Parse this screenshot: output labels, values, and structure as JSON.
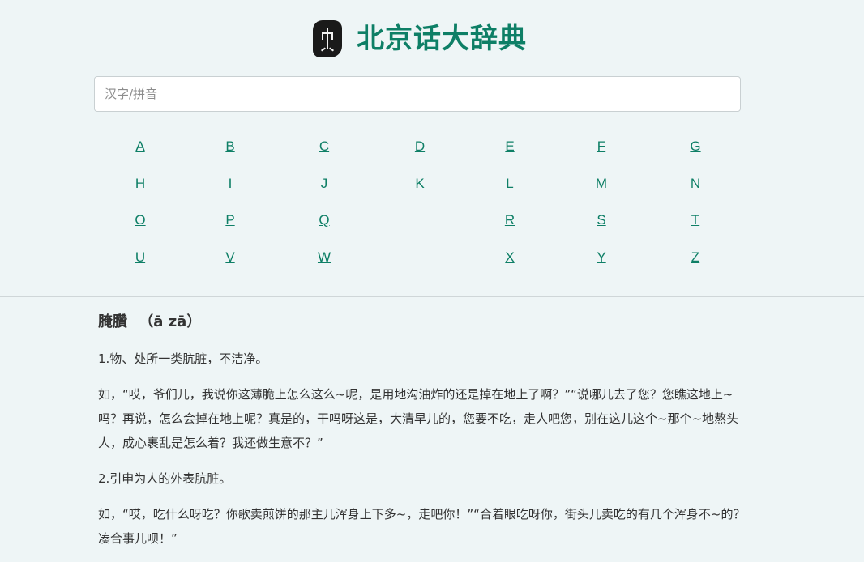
{
  "header": {
    "site_title": "北京话大辞典",
    "logo_icon": "seal-logo-icon"
  },
  "search": {
    "placeholder": "汉字/拼音",
    "value": ""
  },
  "alphabet": {
    "row1": [
      "A",
      "B",
      "C",
      "D",
      "E",
      "F",
      "G"
    ],
    "row2": [
      "H",
      "I",
      "J",
      "K",
      "L",
      "M",
      "N"
    ],
    "row3": [
      "O",
      "P",
      "Q",
      "R",
      "S",
      "T"
    ],
    "row4": [
      "U",
      "V",
      "W",
      "X",
      "Y",
      "Z"
    ]
  },
  "entry": {
    "headword": "腌臢",
    "pinyin": "（ā zā）",
    "def1": "1.物、处所一类肮脏，不洁净。",
    "ex1": "如，“哎，爷们儿，我说你这薄脆上怎么这么~呢，是用地沟油炸的还是掉在地上了啊？”“说哪儿去了您？您瞧这地上~吗？再说，怎么会掉在地上呢？真是的，干吗呀这是，大清早儿的，您要不吃，走人吧您，别在这儿这个~那个~地熬头人，成心裹乱是怎么着？我还做生意不？”",
    "def2": "2.引申为人的外表肮脏。",
    "ex2": "如，“哎，吃什么呀吃？你歌卖煎饼的那主儿浑身上下多~，走吧你！”“合着眼吃呀你，街头儿卖吃的有几个浑身不~的？凑合事儿呗！”"
  }
}
